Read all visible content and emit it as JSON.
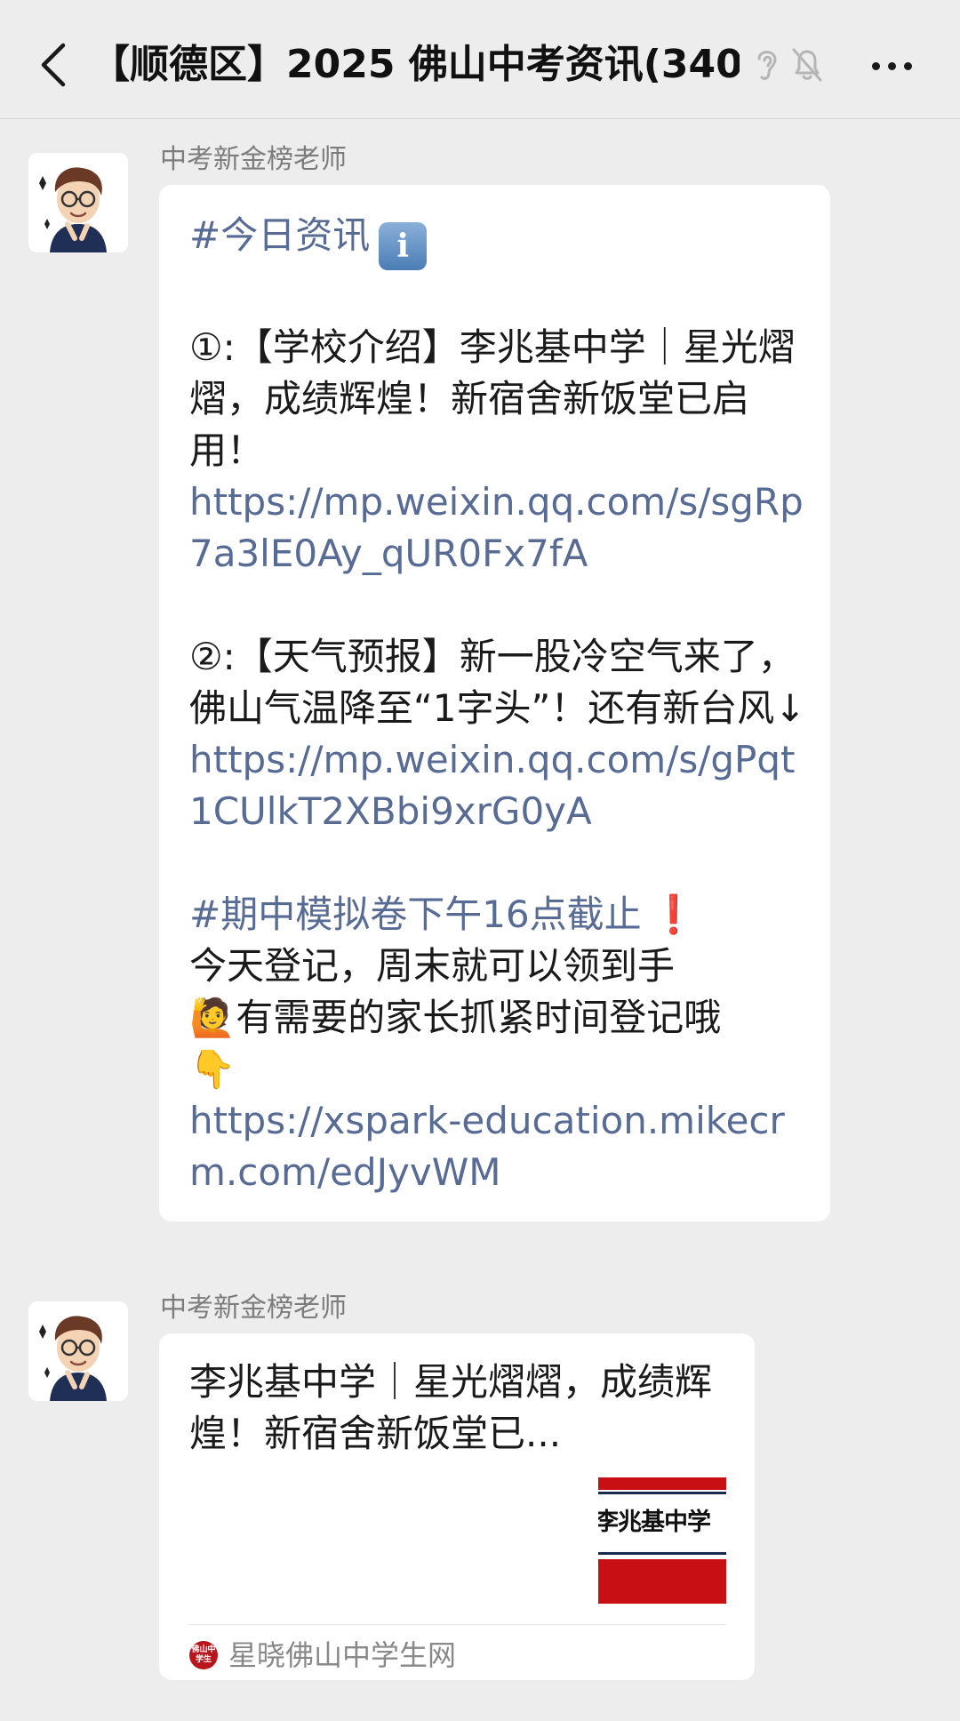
{
  "header": {
    "title": "【顺德区】2025 佛山中考资讯",
    "member_count": "(340)",
    "icons": [
      "back-icon",
      "ear-icon",
      "mute-bell-icon",
      "more-icon"
    ]
  },
  "messages": [
    {
      "sender": "中考新金榜老师",
      "hashtag1": "#今日资讯",
      "info_badge": "i",
      "item1_text": "①:【学校介绍】李兆基中学｜星光熠熠，成绩辉煌！新宿舍新饭堂已启用！",
      "item1_link": "https://mp.weixin.qq.com/s/sgRp7a3lE0Ay_qUR0Fx7fA",
      "item2_text": "②:【天气预报】新一股冷空气来了，佛山气温降至“1字头”！还有新台风↓",
      "item2_link": "https://mp.weixin.qq.com/s/gPqt1CUlkT2XBbi9xrG0yA",
      "hashtag2": "#期中模拟卷下午16点截止",
      "hashtag2_mark": "❗",
      "notice_line1": "今天登记，周末就可以领到手",
      "notice_emoji": "🙋",
      "notice_line2": "有需要的家长抓紧时间登记哦",
      "notice_emoji2": "👇",
      "notice_link": "https://xspark-education.mikecrm.com/edJyvWM"
    },
    {
      "sender": "中考新金榜老师",
      "card_title": "李兆基中学｜星光熠熠，成绩辉煌！新宿舍新饭堂已...",
      "thumb_text": "李兆基中学",
      "source_logo_text": "佛山中学生",
      "source_name": "星晓佛山中学生网"
    }
  ],
  "colors": {
    "background": "#ededed",
    "bubble": "#ffffff",
    "link": "#576b95",
    "sender": "#7c7c7c",
    "thumb_red": "#c80f14"
  }
}
